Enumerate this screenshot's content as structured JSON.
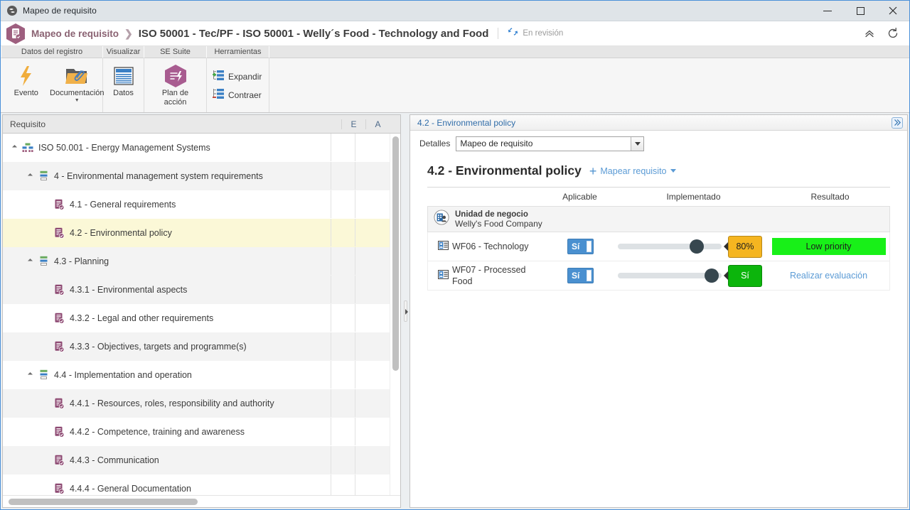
{
  "window": {
    "title": "Mapeo de requisito",
    "icon": "globe-icon",
    "minimize": "—",
    "maximize": "□",
    "close": "✕"
  },
  "header": {
    "breadcrumb_root": "Mapeo de requisito",
    "separator": "❯",
    "title": "ISO 50001 - Tec/PF - ISO 50001 - Welly´s Food - Technology and Food",
    "status": "En revisión",
    "status_icon": "sync-icon",
    "collapse_icon": "chevron-double-up-icon",
    "refresh_icon": "refresh-icon"
  },
  "ribbon": {
    "tabs": [
      {
        "label": "Datos del registro"
      },
      {
        "label": "Visualizar"
      },
      {
        "label": "SE Suite"
      },
      {
        "label": "Herramientas"
      }
    ],
    "buttons": {
      "evento": "Evento",
      "documentacion": "Documentación",
      "datos": "Datos",
      "plan_accion": "Plan de acción",
      "expandir": "Expandir",
      "contraer": "Contraer"
    }
  },
  "tree": {
    "columns": {
      "requisito": "Requisito",
      "e": "E",
      "a": "A"
    },
    "items": [
      {
        "label": "ISO 50.001 - Energy Management Systems",
        "indent": 0,
        "expander": true,
        "icon": "standard-icon",
        "alt": false,
        "selected": false
      },
      {
        "label": "4 - Environmental management system requirements",
        "indent": 1,
        "expander": true,
        "icon": "section-icon",
        "alt": true,
        "selected": false
      },
      {
        "label": "4.1 - General requirements",
        "indent": 2,
        "expander": false,
        "icon": "requirement-icon",
        "alt": false,
        "selected": false
      },
      {
        "label": "4.2 - Environmental policy",
        "indent": 2,
        "expander": false,
        "icon": "requirement-icon",
        "alt": false,
        "selected": true
      },
      {
        "label": "4.3 - Planning",
        "indent": 1,
        "expander": true,
        "icon": "section-icon",
        "alt": true,
        "selected": false
      },
      {
        "label": "4.3.1 - Environmental aspects",
        "indent": 2,
        "expander": false,
        "icon": "requirement-icon",
        "alt": true,
        "selected": false
      },
      {
        "label": "4.3.2 - Legal and other requirements",
        "indent": 2,
        "expander": false,
        "icon": "requirement-icon",
        "alt": false,
        "selected": false
      },
      {
        "label": "4.3.3 - Objectives, targets and programme(s)",
        "indent": 2,
        "expander": false,
        "icon": "requirement-icon",
        "alt": true,
        "selected": false
      },
      {
        "label": "4.4 - Implementation and operation",
        "indent": 1,
        "expander": true,
        "icon": "section-icon",
        "alt": false,
        "selected": false
      },
      {
        "label": "4.4.1 - Resources, roles, responsibility and authority",
        "indent": 2,
        "expander": false,
        "icon": "requirement-icon",
        "alt": true,
        "selected": false
      },
      {
        "label": "4.4.2 - Competence, training and awareness",
        "indent": 2,
        "expander": false,
        "icon": "requirement-icon",
        "alt": false,
        "selected": false
      },
      {
        "label": "4.4.3 - Communication",
        "indent": 2,
        "expander": false,
        "icon": "requirement-icon",
        "alt": true,
        "selected": false
      },
      {
        "label": "4.4.4 - General Documentation",
        "indent": 2,
        "expander": false,
        "icon": "requirement-icon",
        "alt": false,
        "selected": false
      }
    ]
  },
  "detail": {
    "panel_title": "4.2 - Environmental policy",
    "expand_icon": "chevron-double-right-icon",
    "detalles_label": "Detalles",
    "detalles_value": "Mapeo de requisito",
    "title": "4.2 - Environmental policy",
    "map_action": "Mapear requisito",
    "table": {
      "headers": {
        "name": "",
        "applicable": "Aplicable",
        "implemented": "Implementado",
        "result": "Resultado"
      },
      "group": {
        "icon": "business-unit-icon",
        "type_label": "Unidad de negocio",
        "name": "Welly's Food Company"
      },
      "rows": [
        {
          "icon": "org-unit-icon",
          "name": "WF06 - Technology",
          "applicable": "Sí",
          "slider_percent": 80,
          "badge_value": "80%",
          "badge_color": "#f5b520",
          "result_type": "bar",
          "result_label": "Low priority",
          "result_color": "#18f018"
        },
        {
          "icon": "org-unit-icon",
          "name": "WF07 - Processed Food",
          "applicable": "Sí",
          "slider_percent": 97,
          "badge_value": "Sí",
          "badge_color": "#0cb50c",
          "result_type": "link",
          "result_label": "Realizar evaluación",
          "result_color": "#5b9bd5"
        }
      ]
    }
  }
}
